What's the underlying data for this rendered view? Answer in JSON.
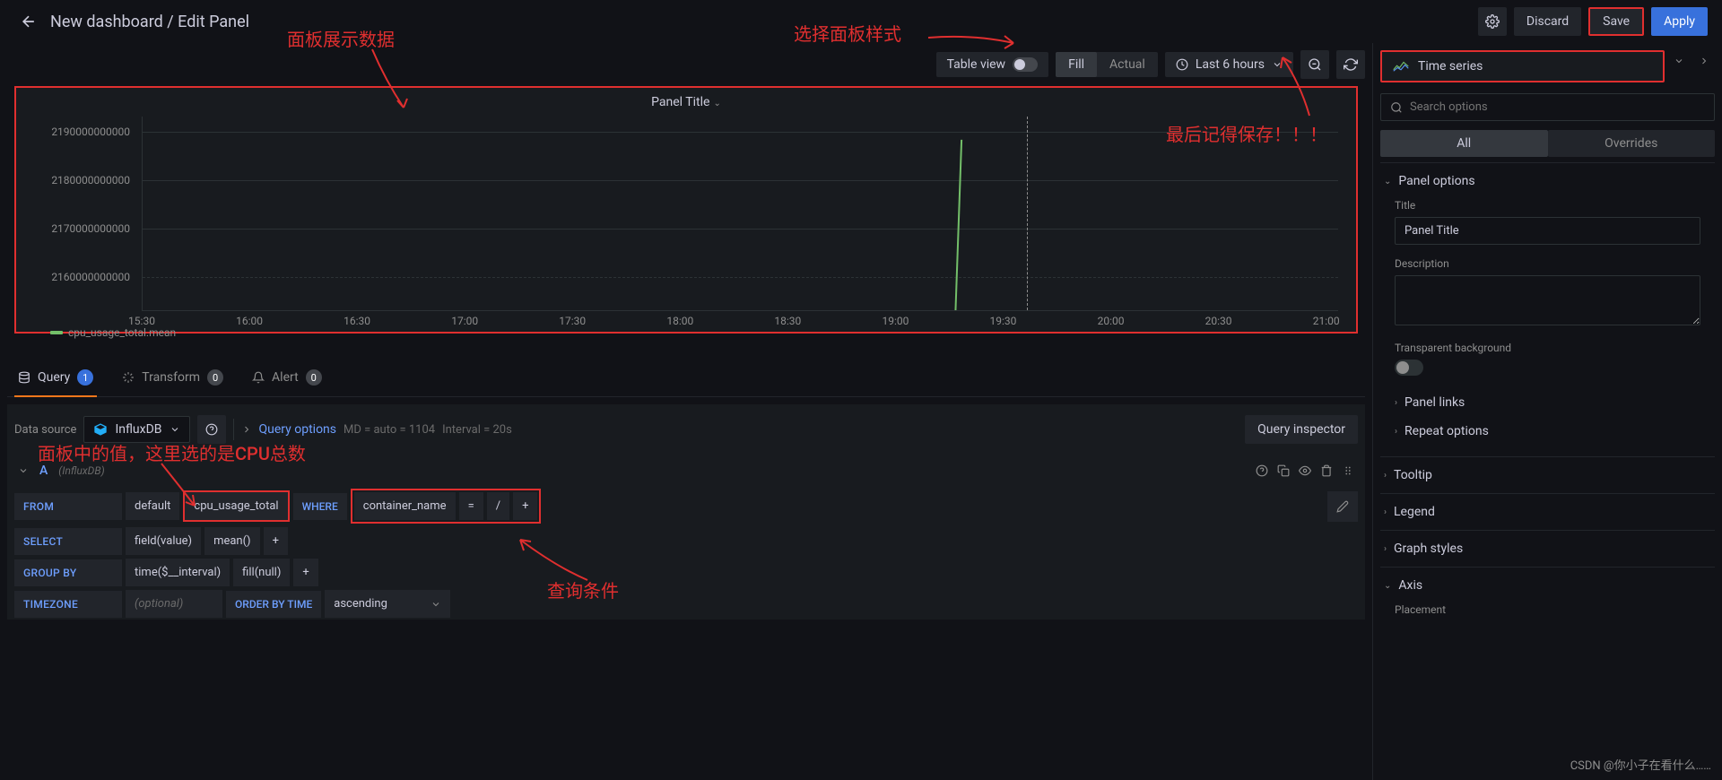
{
  "header": {
    "title": "New dashboard / Edit Panel",
    "discard": "Discard",
    "save": "Save",
    "apply": "Apply"
  },
  "toolbar": {
    "table_view": "Table view",
    "fill": "Fill",
    "actual": "Actual",
    "time_range": "Last 6 hours"
  },
  "panel": {
    "title": "Panel Title",
    "legend": "cpu_usage_total.mean"
  },
  "chart_data": {
    "type": "line",
    "title": "Panel Title",
    "y_ticks": [
      "2190000000000",
      "2180000000000",
      "2170000000000",
      "2160000000000"
    ],
    "ylim": [
      2155000000000,
      2195000000000
    ],
    "x_ticks": [
      "15:30",
      "16:00",
      "16:30",
      "17:00",
      "17:30",
      "18:00",
      "18:30",
      "19:00",
      "19:30",
      "20:00",
      "20:30",
      "21:00"
    ],
    "series": [
      {
        "name": "cpu_usage_total.mean",
        "color": "#73bf69",
        "x": [
          "19:28",
          "19:32"
        ],
        "values": [
          2155000000000,
          2190000000000
        ]
      }
    ],
    "cursor_x": "19:52"
  },
  "tabs": {
    "query": "Query",
    "query_count": "1",
    "transform": "Transform",
    "transform_count": "0",
    "alert": "Alert",
    "alert_count": "0"
  },
  "datasource": {
    "label": "Data source",
    "name": "InfluxDB",
    "query_options": "Query options",
    "md_info": "MD = auto = 1104",
    "interval_info": "Interval = 20s",
    "inspector": "Query inspector"
  },
  "query": {
    "name": "A",
    "ds": "(InfluxDB)",
    "from": "FROM",
    "default": "default",
    "measurement": "cpu_usage_total",
    "where": "WHERE",
    "tag_key": "container_name",
    "eq": "=",
    "slash": "/",
    "plus": "+",
    "select": "SELECT",
    "field": "field(value)",
    "mean": "mean()",
    "groupby": "GROUP BY",
    "time": "time($__interval)",
    "fill": "fill(null)",
    "timezone": "TIMEZONE",
    "optional": "(optional)",
    "orderby": "ORDER BY TIME",
    "ascending": "ascending"
  },
  "right": {
    "viz_name": "Time series",
    "search_placeholder": "Search options",
    "all": "All",
    "overrides": "Overrides",
    "panel_options": "Panel options",
    "title_label": "Title",
    "title_value": "Panel Title",
    "desc_label": "Description",
    "transparent": "Transparent background",
    "panel_links": "Panel links",
    "repeat": "Repeat options",
    "tooltip": "Tooltip",
    "legend": "Legend",
    "graph_styles": "Graph styles",
    "axis": "Axis",
    "placement": "Placement"
  },
  "annotations": {
    "a1": "面板展示数据",
    "a2": "选择面板样式",
    "a3": "最后记得保存！！！",
    "a4": "面板中的值，这里选的是CPU总数",
    "a5": "查询条件"
  },
  "watermark": "CSDN @你小子在看什么……"
}
